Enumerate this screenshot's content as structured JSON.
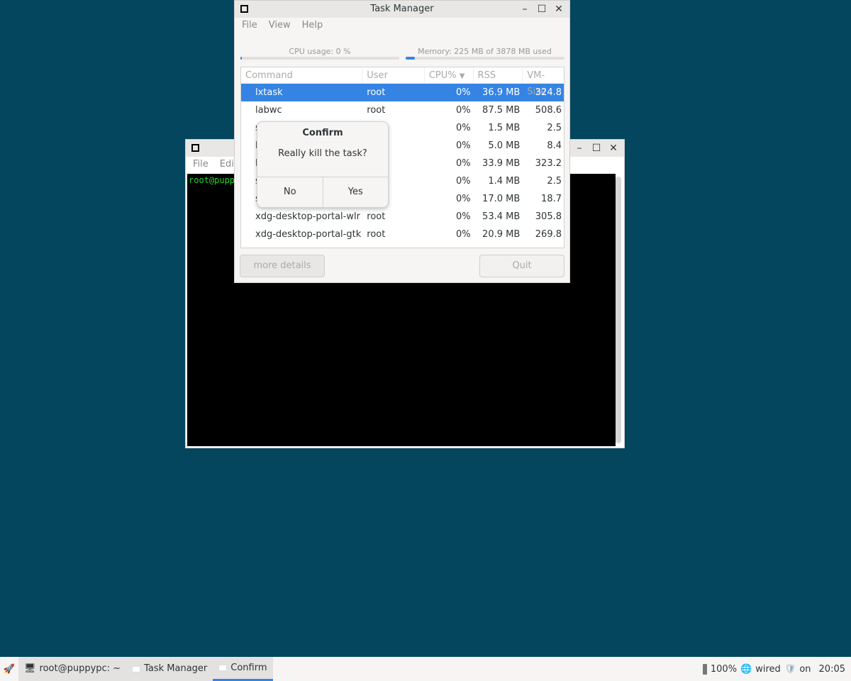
{
  "terminal": {
    "title": "",
    "menu": [
      "File",
      "Edit"
    ],
    "prompt": "root@puppypc:~#"
  },
  "task_manager": {
    "title": "Task Manager",
    "menu": [
      "File",
      "View",
      "Help"
    ],
    "cpu_label": "CPU usage: 0 %",
    "cpu_percent": 0,
    "mem_label": "Memory: 225 MB of 3878 MB used",
    "mem_percent": 5.8,
    "columns": [
      "Command",
      "User",
      "CPU%",
      "RSS",
      "VM-Size"
    ],
    "sort_column": "CPU%",
    "sort_icon": "triangle-down-icon",
    "rows": [
      [
        "lxtask",
        "root",
        "0%",
        "36.9 MB",
        "324.8"
      ],
      [
        "labwc",
        "root",
        "0%",
        "87.5 MB",
        "508.6"
      ],
      [
        "s",
        "",
        "0%",
        "1.5 MB",
        "2.5"
      ],
      [
        "l",
        "",
        "0%",
        "5.0 MB",
        "8.4"
      ],
      [
        "l",
        "",
        "0%",
        "33.9 MB",
        "323.2"
      ],
      [
        "s",
        "",
        "0%",
        "1.4 MB",
        "2.5"
      ],
      [
        "s",
        "",
        "0%",
        "17.0 MB",
        "18.7"
      ],
      [
        "xdg-desktop-portal-wlr",
        "root",
        "0%",
        "53.4 MB",
        "305.8"
      ],
      [
        "xdg-desktop-portal-gtk",
        "root",
        "0%",
        "20.9 MB",
        "269.8"
      ]
    ],
    "selected_row": 0,
    "more_details": "more details",
    "quit": "Quit"
  },
  "dialog": {
    "title": "Confirm",
    "message": "Really kill the task?",
    "no": "No",
    "yes": "Yes"
  },
  "taskbar": {
    "items": [
      {
        "label": "root@puppypc: ~",
        "icon": "terminal-icon"
      },
      {
        "label": "Task Manager",
        "icon": "window-icon"
      },
      {
        "label": "Confirm",
        "icon": "window-icon",
        "active": true
      }
    ],
    "volume": "100%",
    "network": "wired",
    "firewall": "on",
    "clock": "20:05"
  },
  "colors": {
    "desktop": "#04465e",
    "accent": "#3584e4",
    "prompt": "#2bd52b"
  }
}
